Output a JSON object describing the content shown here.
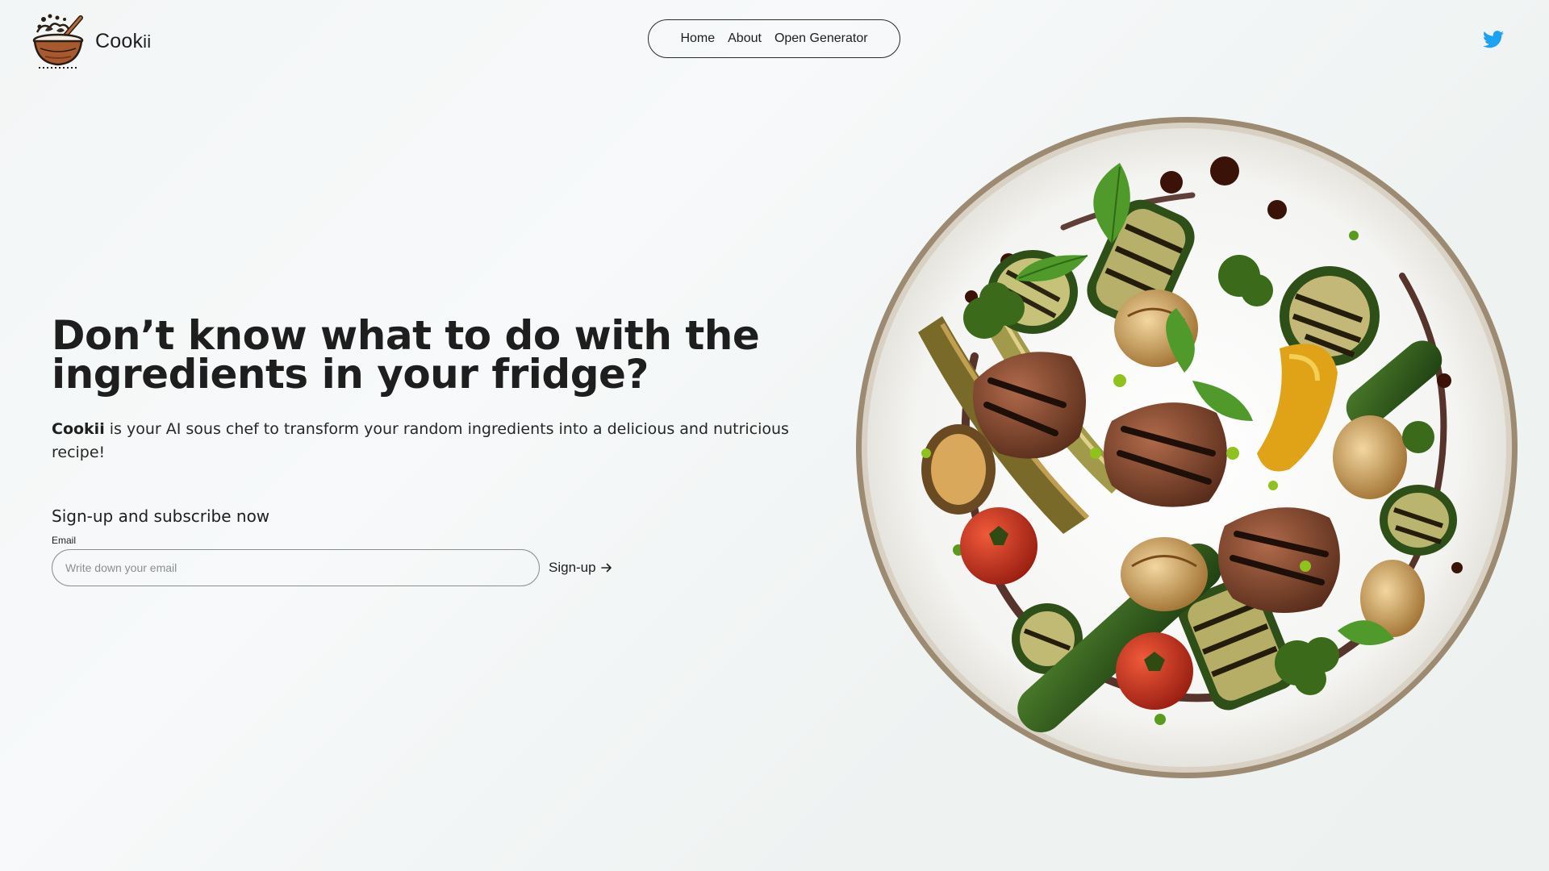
{
  "brand": {
    "name_main": "Cook",
    "name_suffix": "ii",
    "logo_icon": "cooking-bowl-logo-icon"
  },
  "nav": {
    "items": [
      {
        "label": "Home"
      },
      {
        "label": "About"
      },
      {
        "label": "Open Generator"
      }
    ]
  },
  "social": {
    "twitter_icon": "twitter-icon",
    "twitter_color": "#1DA1F2"
  },
  "hero": {
    "title": "Don’t know what to do with the ingredients in your fridge?",
    "desc_brand": "Cookii",
    "desc_rest": " is your AI sous chef to transform your random ingredients into a delicious and nutricious recipe!"
  },
  "subscribe": {
    "heading": "Sign-up and subscribe now",
    "email_label": "Email",
    "email_placeholder": "Write down your email",
    "email_value": "",
    "button_label": "Sign-up",
    "button_icon": "arrow-right-icon"
  },
  "image": {
    "subject": "grilled-vegetables-plate-image"
  }
}
